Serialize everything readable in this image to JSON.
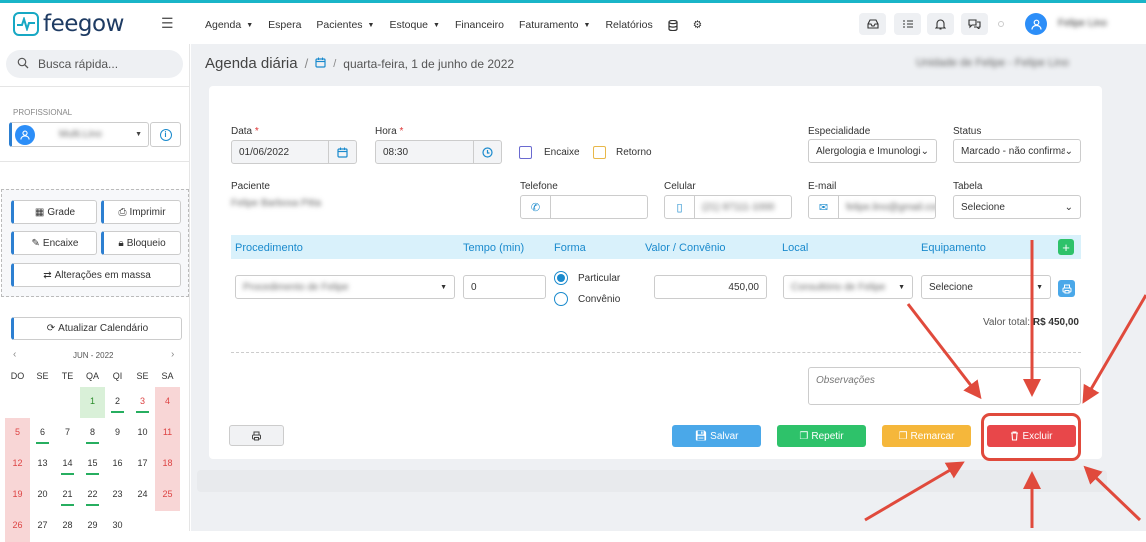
{
  "app": {
    "logo_text": "feegow",
    "user_name": "Felipe Lino"
  },
  "nav": [
    "Agenda",
    "Espera",
    "Pacientes",
    "Estoque",
    "Financeiro",
    "Faturamento",
    "Relatórios"
  ],
  "nav_dropdowns": [
    true,
    false,
    true,
    true,
    false,
    true,
    false
  ],
  "search": {
    "placeholder": "Busca rápida..."
  },
  "breadcrumb": {
    "title": "Agenda diária",
    "sep": "/",
    "date": "quarta-feira, 1 de junho de 2022",
    "unit": "Unidade de Felipe - Felipe Lino"
  },
  "sidebar": {
    "prof_label": "PROFISSIONAL",
    "prof_name": "Multi.Lino",
    "grade": "Grade",
    "imprimir": "Imprimir",
    "encaixe": "Encaixe",
    "bloqueio": "Bloqueio",
    "alteracoes": "Alterações em massa",
    "atualizar": "Atualizar Calendário"
  },
  "calendar": {
    "month": "JUN - 2022",
    "weekdays": [
      "DO",
      "SE",
      "TE",
      "QA",
      "QI",
      "SE",
      "SA"
    ],
    "days": [
      [
        "",
        "",
        "",
        "1",
        "2",
        "3",
        "4"
      ],
      [
        "5",
        "6",
        "7",
        "8",
        "9",
        "10",
        "11"
      ],
      [
        "12",
        "13",
        "14",
        "15",
        "16",
        "17",
        "18"
      ],
      [
        "19",
        "20",
        "21",
        "22",
        "23",
        "24",
        "25"
      ],
      [
        "26",
        "27",
        "28",
        "29",
        "30",
        "",
        ""
      ]
    ]
  },
  "form": {
    "data_label": "Data",
    "data_value": "01/06/2022",
    "hora_label": "Hora",
    "hora_value": "08:30",
    "encaixe": "Encaixe",
    "retorno": "Retorno",
    "especialidade_label": "Especialidade",
    "especialidade_value": "Alergologia e Imunologia",
    "status_label": "Status",
    "status_value": "Marcado - não confirmado",
    "paciente_label": "Paciente",
    "paciente_value": "Felipe Barbosa Pitta",
    "telefone_label": "Telefone",
    "celular_label": "Celular",
    "celular_value": "(21) 97111-1000",
    "email_label": "E-mail",
    "email_value": "felipe.lino@gmail.com",
    "tabela_label": "Tabela",
    "tabela_value": "Selecione"
  },
  "proc": {
    "headers": [
      "Procedimento",
      "Tempo (min)",
      "Forma",
      "Valor / Convênio",
      "Local",
      "Equipamento"
    ],
    "procedimento": "Procedimento de Felipe",
    "tempo": "0",
    "particular": "Particular",
    "convenio": "Convênio",
    "valor": "450,00",
    "local": "Consultório de Felipe",
    "equipamento": "Selecione",
    "total_label": "Valor total:",
    "total_value": "R$ 450,00"
  },
  "observacoes": {
    "placeholder": "Observações"
  },
  "actions": {
    "salvar": "Salvar",
    "repetir": "Repetir",
    "remarcar": "Remarcar",
    "excluir": "Excluir"
  },
  "colors": {
    "salvar": "#4aa8e9",
    "repetir": "#2ec26a",
    "remarcar": "#f5b73b",
    "excluir": "#e8474a",
    "highlight": "#e04a3c",
    "accent": "#1a8acd"
  }
}
